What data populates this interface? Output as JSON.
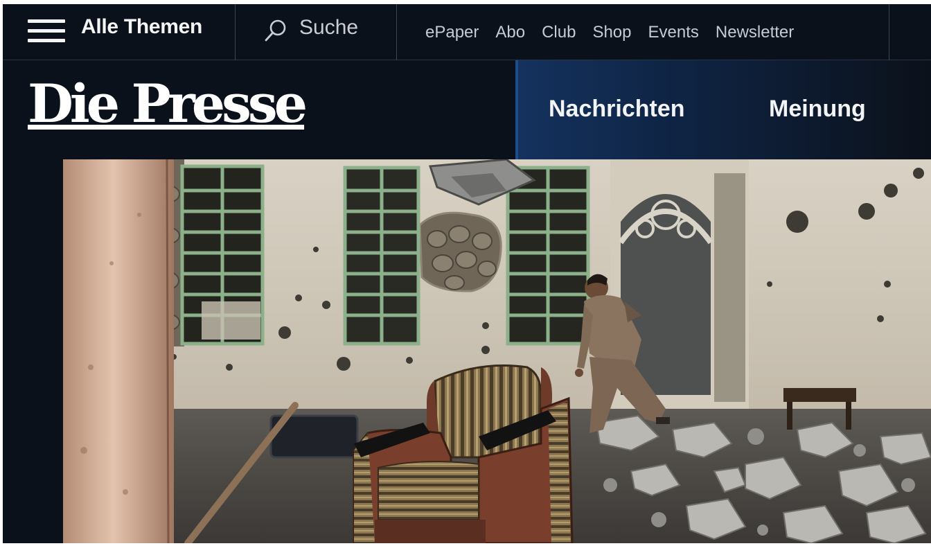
{
  "topbar": {
    "menu_label": "Alle Themen",
    "search_label": "Suche",
    "links": [
      "ePaper",
      "Abo",
      "Club",
      "Shop",
      "Events",
      "Newsletter"
    ]
  },
  "brand": {
    "logo": "Die Presse"
  },
  "main_nav": {
    "items": [
      "Nachrichten",
      "Meinung"
    ]
  },
  "icons": {
    "menu": "hamburger-menu-icon",
    "search": "search-icon"
  },
  "colors": {
    "header_background": "#0b111a",
    "nav_accent": "#14325e",
    "text": "#f5f5f5"
  }
}
